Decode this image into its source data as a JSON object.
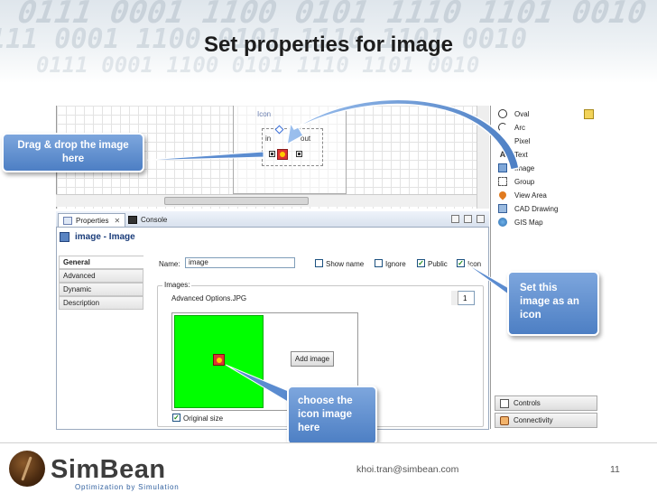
{
  "slide": {
    "title": "Set properties for image",
    "header_pattern": "0111 0001 1100 0101 1110 1101 0010"
  },
  "canvas": {
    "icon_label": "Icon",
    "in_label": "in",
    "out_label": "out"
  },
  "palette": {
    "items": [
      {
        "label": "Oval",
        "icon": "oval-icon"
      },
      {
        "label": "Arc",
        "icon": "arc-icon"
      },
      {
        "label": "Pixel",
        "icon": "pixel-icon"
      },
      {
        "label": "Text",
        "icon": "text-icon"
      },
      {
        "label": "Image",
        "icon": "image-icon"
      },
      {
        "label": "Group",
        "icon": "group-icon"
      },
      {
        "label": "View Area",
        "icon": "view-area-icon"
      },
      {
        "label": "CAD Drawing",
        "icon": "cad-drawing-icon"
      },
      {
        "label": "GIS Map",
        "icon": "gis-map-icon"
      }
    ],
    "sections": [
      {
        "label": "Controls",
        "icon": "controls-icon"
      },
      {
        "label": "Connectivity",
        "icon": "connectivity-icon"
      }
    ]
  },
  "properties": {
    "tab_properties": "Properties",
    "tab_console": "Console",
    "title": "image - Image",
    "side_tabs": [
      "General",
      "Advanced",
      "Dynamic",
      "Description"
    ],
    "name_label": "Name:",
    "name_value": "image",
    "checkboxes": [
      {
        "label": "Show name",
        "checked": false
      },
      {
        "label": "Ignore",
        "checked": false
      },
      {
        "label": "Public",
        "checked": true
      },
      {
        "label": "Icon",
        "checked": true
      }
    ],
    "images_legend": "Images:",
    "image_file": "Advanced Options.JPG",
    "spinner_value": "1",
    "add_image_label": "Add image",
    "original_size_label": "Original size",
    "original_size_checked": true
  },
  "callouts": {
    "drag_drop": "Drag & drop the image here",
    "set_icon": "Set this image as an icon",
    "choose_icon": "choose the icon image here"
  },
  "footer": {
    "brand": "SimBean",
    "tagline": "Optimization by Simulation",
    "email": "khoi.tran@simbean.com",
    "page_number": "11"
  },
  "colors": {
    "callout_blue": "#5b8cd0",
    "brand_blue": "#2f5f9e",
    "green_image": "#00ff00"
  }
}
